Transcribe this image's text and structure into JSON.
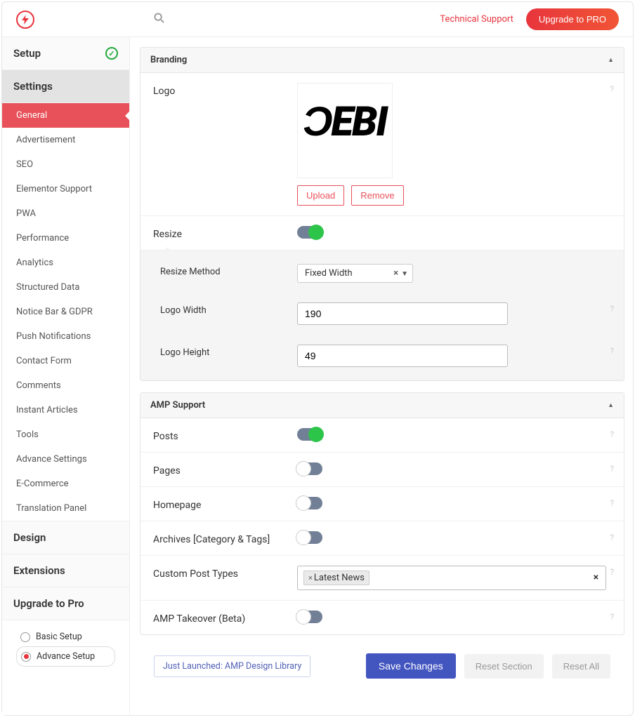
{
  "topbar": {
    "technical_support": "Technical Support",
    "upgrade_btn": "Upgrade to PRO"
  },
  "sidebar": {
    "setup_label": "Setup",
    "settings_label": "Settings",
    "settings_items": [
      "General",
      "Advertisement",
      "SEO",
      "Elementor Support",
      "PWA",
      "Performance",
      "Analytics",
      "Structured Data",
      "Notice Bar & GDPR",
      "Push Notifications",
      "Contact Form",
      "Comments",
      "Instant Articles",
      "Tools",
      "Advance Settings",
      "E-Commerce",
      "Translation Panel"
    ],
    "design_label": "Design",
    "extensions_label": "Extensions",
    "upgrade_pro_label": "Upgrade to Pro",
    "radio_basic": "Basic Setup",
    "radio_advance": "Advance Setup"
  },
  "branding": {
    "section_title": "Branding",
    "logo_label": "Logo",
    "logo_text": "ƆEBI",
    "upload_btn": "Upload",
    "remove_btn": "Remove",
    "resize_label": "Resize",
    "resize_method_label": "Resize Method",
    "resize_method_value": "Fixed Width",
    "logo_width_label": "Logo Width",
    "logo_width_value": "190",
    "logo_height_label": "Logo Height",
    "logo_height_value": "49"
  },
  "amp": {
    "section_title": "AMP Support",
    "posts_label": "Posts",
    "pages_label": "Pages",
    "homepage_label": "Homepage",
    "archives_label": "Archives [Category & Tags]",
    "custom_post_types_label": "Custom Post Types",
    "custom_post_types_chip": "Latest News",
    "takeover_label": "AMP Takeover (Beta)"
  },
  "footer": {
    "just_launched": "Just Launched: AMP Design Library",
    "save": "Save Changes",
    "reset_section": "Reset Section",
    "reset_all": "Reset All"
  }
}
